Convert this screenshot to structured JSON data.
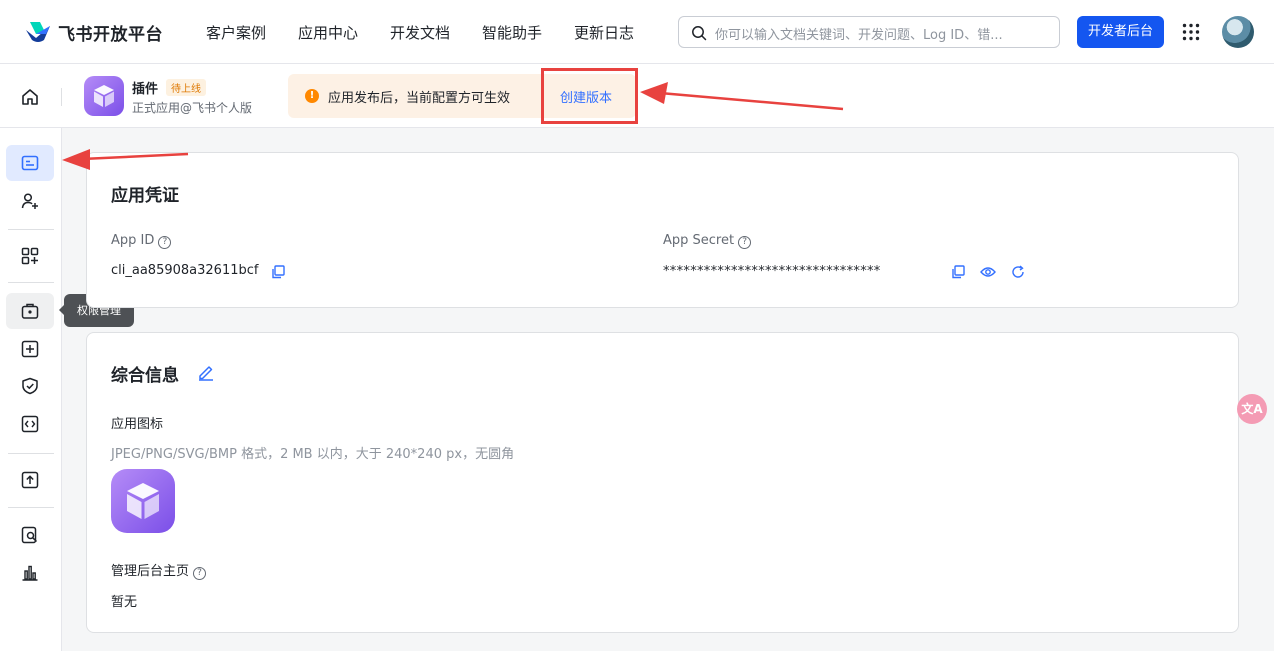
{
  "topnav": {
    "brand": "飞书开放平台",
    "items": [
      "客户案例",
      "应用中心",
      "开发文档",
      "智能助手",
      "更新日志"
    ],
    "search_placeholder": "你可以输入文档关键词、开发问题、Log ID、错...",
    "dev_button": "开发者后台"
  },
  "app": {
    "name": "插件",
    "status_badge": "待上线",
    "subtitle": "正式应用@飞书个人版"
  },
  "notice": {
    "text": "应用发布后，当前配置方可生效",
    "action": "创建版本"
  },
  "sidebar": {
    "tooltip": "权限管理"
  },
  "credentials": {
    "title": "应用凭证",
    "app_id_label": "App ID",
    "app_id_value": "cli_aa85908a32611bcf",
    "app_secret_label": "App Secret",
    "app_secret_value": "********************************"
  },
  "info": {
    "title": "综合信息",
    "icon_label": "应用图标",
    "icon_hint": "JPEG/PNG/SVG/BMP 格式，2 MB 以内，大于 240*240 px，无圆角",
    "homepage_label": "管理后台主页",
    "homepage_value": "暂无"
  },
  "colors": {
    "primary": "#1456f0",
    "annotation_red": "#e8423f",
    "notice_bg": "#fdf1e5"
  }
}
